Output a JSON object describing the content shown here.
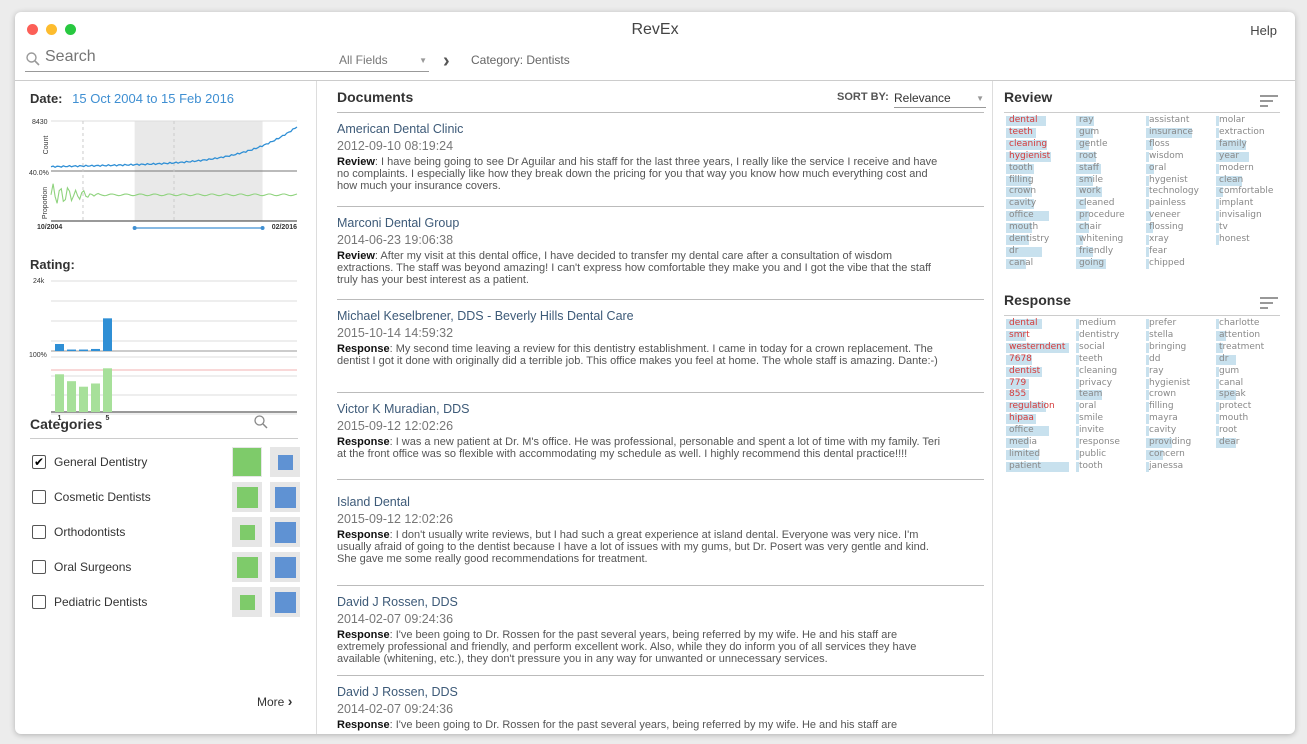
{
  "app": {
    "title": "RevEx",
    "help": "Help"
  },
  "search": {
    "placeholder": "Search",
    "fields": "All Fields",
    "breadcrumb": "Category: Dentists"
  },
  "date": {
    "label": "Date:",
    "range": "15 Oct 2004 to 15 Feb 2016"
  },
  "timechart": {
    "count_max": "8430",
    "count_label": "Count",
    "proportion_tick": "40.0%",
    "proportion_label": "Proportion",
    "x_start": "10/2004",
    "x_end": "02/2016",
    "selection_start": 0.34,
    "selection_end": 0.86
  },
  "rating": {
    "label": "Rating:",
    "count_tick": "24k",
    "prop_tick": "100%",
    "x_start": "1",
    "x_end": "5",
    "counts": [
      2400,
      500,
      500,
      700,
      11200
    ],
    "proportions": [
      0.82,
      0.67,
      0.55,
      0.62,
      0.95
    ],
    "selected_index": 4
  },
  "categories": {
    "title": "Categories",
    "items": [
      {
        "label": "General Dentistry",
        "checked": true,
        "green": 1.0,
        "blue": 0.55
      },
      {
        "label": "Cosmetic Dentists",
        "checked": false,
        "green": 0.75,
        "blue": 0.75
      },
      {
        "label": "Orthodontists",
        "checked": false,
        "green": 0.55,
        "blue": 0.75
      },
      {
        "label": "Oral Surgeons",
        "checked": false,
        "green": 0.75,
        "blue": 0.75
      },
      {
        "label": "Pediatric Dentists",
        "checked": false,
        "green": 0.55,
        "blue": 0.75
      }
    ],
    "more": "More",
    "check_mark": "✔"
  },
  "documents": {
    "title": "Documents",
    "sort_label": "SORT BY:",
    "sort_value": "Relevance",
    "items": [
      {
        "title": "American Dental Clinic",
        "date": "2012-09-10 08:19:24",
        "kind": "Review",
        "text": ": I have being going to see Dr Aguilar and his staff for the last three years, I really like the service I receive and have no complaints. I especially like how they break down the pricing for you that way you know how much everything cost and how much your insurance covers."
      },
      {
        "title": "Marconi Dental Group",
        "date": "2014-06-23 19:06:38",
        "kind": "Review",
        "text": ": After my visit at this dental office, I have decided to transfer my dental care after a consultation of wisdom extractions. The staff was beyond amazing! I can't express how comfortable they make you and I got the vibe that the staff truly has your best interest as a patient."
      },
      {
        "title": "Michael Keselbrener, DDS - Beverly Hills Dental Care",
        "date": "2015-10-14 14:59:32",
        "kind": "Response",
        "text": ": My second time leaving a review for this dentistry establishment. I came in today for a crown replacement. The dentist I got it done with originally did a terrible job. This office makes you feel at home. The whole staff is amazing. Dante:-)"
      },
      {
        "title": "Victor K Muradian, DDS",
        "date": "2015-09-12 12:02:26",
        "kind": "Response",
        "text": ": I was a new patient at Dr. M's office. He was professional, personable and spent a lot of time with my family. Teri at the front office was so flexible with accommodating my schedule as well. I highly recommend this dental practice!!!!"
      },
      {
        "title": "Island Dental",
        "date": "2015-09-12 12:02:26",
        "kind": "Response",
        "text": ": I don't usually write reviews, but I had such a great experience at island dental. Everyone was very nice. I'm usually afraid of going to the dentist because I have a lot of issues with my gums, but Dr. Posert was very gentle and kind. She gave me some really good recommendations for treatment."
      },
      {
        "title": "David J Rossen, DDS",
        "date": "2014-02-07 09:24:36",
        "kind": "Response",
        "text": ": I've been going to Dr. Rossen for the past several years, being referred by my wife. He and his staff are extremely professional and friendly, and perform excellent work. Also, while they do inform you of all services they have available (whitening, etc.), they don't pressure you in any way for unwanted or unnecessary services."
      },
      {
        "title": "David J Rossen, DDS",
        "date": "2014-02-07 09:24:36",
        "kind": "Response",
        "text": ": I've been going to Dr. Rossen for the past several years, being referred by my wife. He and his staff are"
      }
    ]
  },
  "review_words": {
    "title": "Review",
    "columns": [
      [
        [
          "dental",
          0.6,
          1
        ],
        [
          "teeth",
          0.45,
          1
        ],
        [
          "cleaning",
          0.62,
          1
        ],
        [
          "hygienist",
          0.68,
          1
        ],
        [
          "tooth",
          0.42,
          0
        ],
        [
          "filling",
          0.38,
          0
        ],
        [
          "crown",
          0.4,
          0
        ],
        [
          "cavity",
          0.42,
          0
        ],
        [
          "office",
          0.65,
          0
        ],
        [
          "mouth",
          0.4,
          0
        ],
        [
          "dentistry",
          0.35,
          0
        ],
        [
          "dr",
          0.55,
          0
        ],
        [
          "canal",
          0.3,
          0
        ]
      ],
      [
        [
          "ray",
          0.28,
          0
        ],
        [
          "gum",
          0.25,
          0
        ],
        [
          "gentle",
          0.2,
          0
        ],
        [
          "root",
          0.3,
          0
        ],
        [
          "staff",
          0.38,
          0
        ],
        [
          "smile",
          0.25,
          0
        ],
        [
          "work",
          0.4,
          0
        ],
        [
          "cleaned",
          0.15,
          0
        ],
        [
          "procedure",
          0.2,
          0
        ],
        [
          "chair",
          0.2,
          0
        ],
        [
          "whitening",
          0.1,
          0
        ],
        [
          "friendly",
          0.25,
          0
        ],
        [
          "going",
          0.45,
          0
        ]
      ],
      [
        [
          "assistant",
          0.05,
          0
        ],
        [
          "insurance",
          0.7,
          0
        ],
        [
          "floss",
          0.1,
          0
        ],
        [
          "wisdom",
          0.05,
          0
        ],
        [
          "oral",
          0.12,
          0
        ],
        [
          "hygenist",
          0.05,
          0
        ],
        [
          "technology",
          0.05,
          0
        ],
        [
          "painless",
          0.05,
          0
        ],
        [
          "veneer",
          0.08,
          0
        ],
        [
          "flossing",
          0.1,
          0
        ],
        [
          "xray",
          0.05,
          0
        ],
        [
          "fear",
          0.05,
          0
        ],
        [
          "chipped",
          0.05,
          0
        ]
      ],
      [
        [
          "molar",
          0.05,
          0
        ],
        [
          "extraction",
          0.05,
          0
        ],
        [
          "family",
          0.45,
          0
        ],
        [
          "year",
          0.5,
          0
        ],
        [
          "modern",
          0.05,
          0
        ],
        [
          "clean",
          0.4,
          0
        ],
        [
          "comfortable",
          0.1,
          0
        ],
        [
          "implant",
          0.05,
          0
        ],
        [
          "invisalign",
          0.05,
          0
        ],
        [
          "tv",
          0.05,
          0
        ],
        [
          "honest",
          0.05,
          0
        ]
      ]
    ]
  },
  "response_words": {
    "title": "Response",
    "columns": [
      [
        [
          "dental",
          0.55,
          1
        ],
        [
          "smrt",
          0.3,
          1
        ],
        [
          "westerndent",
          0.95,
          1
        ],
        [
          "7678",
          0.4,
          1
        ],
        [
          "dentist",
          0.55,
          1
        ],
        [
          "779",
          0.35,
          1
        ],
        [
          "855",
          0.35,
          1
        ],
        [
          "regulation",
          0.6,
          1
        ],
        [
          "hipaa",
          0.45,
          1
        ],
        [
          "office",
          0.65,
          0
        ],
        [
          "media",
          0.35,
          0
        ],
        [
          "limited",
          0.5,
          0
        ],
        [
          "patient",
          0.95,
          0
        ]
      ],
      [
        [
          "medium",
          0.05,
          0
        ],
        [
          "dentistry",
          0.05,
          0
        ],
        [
          "social",
          0.05,
          0
        ],
        [
          "teeth",
          0.05,
          0
        ],
        [
          "cleaning",
          0.05,
          0
        ],
        [
          "privacy",
          0.05,
          0
        ],
        [
          "team",
          0.4,
          0
        ],
        [
          "oral",
          0.05,
          0
        ],
        [
          "smile",
          0.05,
          0
        ],
        [
          "invite",
          0.05,
          0
        ],
        [
          "response",
          0.05,
          0
        ],
        [
          "public",
          0.05,
          0
        ],
        [
          "tooth",
          0.05,
          0
        ]
      ],
      [
        [
          "prefer",
          0.05,
          0
        ],
        [
          "stella",
          0.05,
          0
        ],
        [
          "bringing",
          0.05,
          0
        ],
        [
          "dd",
          0.05,
          0
        ],
        [
          "ray",
          0.05,
          0
        ],
        [
          "hygienist",
          0.05,
          0
        ],
        [
          "crown",
          0.05,
          0
        ],
        [
          "filling",
          0.05,
          0
        ],
        [
          "mayra",
          0.05,
          0
        ],
        [
          "cavity",
          0.05,
          0
        ],
        [
          "providing",
          0.4,
          0
        ],
        [
          "concern",
          0.25,
          0
        ],
        [
          "janessa",
          0.05,
          0
        ]
      ],
      [
        [
          "charlotte",
          0.05,
          0
        ],
        [
          "attention",
          0.15,
          0
        ],
        [
          "treatment",
          0.1,
          0
        ],
        [
          "dr",
          0.3,
          0
        ],
        [
          "gum",
          0.05,
          0
        ],
        [
          "canal",
          0.05,
          0
        ],
        [
          "speak",
          0.3,
          0
        ],
        [
          "protect",
          0.05,
          0
        ],
        [
          "mouth",
          0.05,
          0
        ],
        [
          "root",
          0.05,
          0
        ],
        [
          "dear",
          0.3,
          0
        ]
      ]
    ]
  },
  "colors": {
    "accent_blue": "#3f8fd2",
    "green": "#7ecb6a",
    "bar_blue": "#2f8fd5",
    "highlight": "#c8e1ee",
    "red_word": "#d43a3a"
  }
}
